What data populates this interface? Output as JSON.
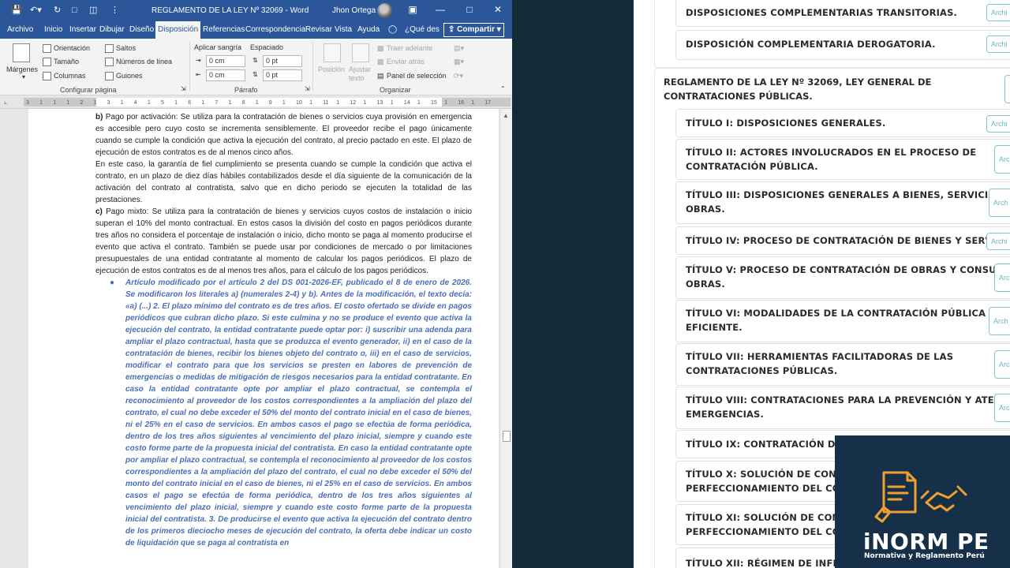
{
  "word": {
    "title": "REGLAMENTO DE LA LEY Nº 32069  -  Word",
    "user": "Jhon Ortega",
    "tabs": [
      "Archivo",
      "Inicio",
      "Insertar",
      "Dibujar",
      "Diseño",
      "Disposición",
      "Referencias",
      "Correspondencia",
      "Revisar",
      "Vista",
      "Ayuda"
    ],
    "active_tab": "Disposición",
    "tell_me": "¿Qué des",
    "share": "Compartir",
    "ribbon": {
      "margins": "Márgenes",
      "orientation": "Orientación",
      "size": "Tamaño",
      "columns": "Columnas",
      "breaks": "Saltos",
      "line_numbers": "Números de línea",
      "hyphenation": "Guiones",
      "group_page_setup": "Configurar página",
      "indent_label": "Aplicar sangría",
      "spacing_label": "Espaciado",
      "indent_left": "0 cm",
      "indent_right": "0 cm",
      "spacing_before": "0 pt",
      "spacing_after": "0 pt",
      "group_paragraph": "Párrafo",
      "position": "Posición",
      "wrap_line1": "Ajustar",
      "wrap_line2": "texto",
      "bring_forward": "Traer adelante",
      "send_backward": "Enviar atrás",
      "selection_pane": "Panel de selección",
      "group_arrange": "Organizar"
    },
    "ruler_ticks": [
      "3",
      "1",
      "1",
      "1",
      "2",
      "1",
      "3",
      "1",
      "4",
      "1",
      "5",
      "1",
      "6",
      "1",
      "7",
      "1",
      "8",
      "1",
      "9",
      "1",
      "10",
      "1",
      "11",
      "1",
      "12",
      "1",
      "13",
      "1",
      "14",
      "1",
      "15",
      "1",
      "16",
      "1",
      "17"
    ],
    "doc": {
      "para_b_label": "b)",
      "para_b": "Pago por activación: Se utiliza para la contratación de bienes o servicios cuya provisión en emergencia es accesible pero cuyo costo se incrementa sensiblemente. El proveedor recibe el pago únicamente cuando se cumple la condición que activa la ejecución del contrato, al precio pactado en este. El plazo de ejecución de estos contratos es de al menos cinco años.",
      "para_guarantee": "En este caso, la garantía de fiel cumplimiento se presenta cuando se cumple la condición que activa el contrato, en un plazo de diez días hábiles contabilizados desde el día siguiente de la comunicación de la activación del contrato al contratista, salvo que en dicho periodo se ejecuten la totalidad de las prestaciones.",
      "para_c_label": "c)",
      "para_c": "Pago mixto: Se utiliza para la contratación de bienes y servicios cuyos costos de instalación o inicio superan el 10% del monto contractual. En estos casos la división del costo en pagos periódicos durante tres años no considera el porcentaje de instalación o inicio, dicho monto se paga al momento producirse el evento que activa el contrato. También se puede usar por condiciones de mercado o por limitaciones presupuestales de una entidad contratante al momento de calcular los pagos periódicos. El plazo de ejecución de estos contratos es de al menos tres años, para el cálculo de los pagos periódicos.",
      "note": "Artículo modificado por el artículo 2 del DS 001-2026-EF, publicado el 8 de enero de 2026. Se modificaron los literales a) (numerales 2-4) y b). Antes de la modificación, el texto decía: «a) (...) 2. El plazo mínimo del contrato es de tres años. El costo ofertado se divide en pagos periódicos que cubran dicho plazo. Si este culmina y no se produce el evento que activa la ejecución del contrato, la entidad contratante puede optar por: i) suscribir una adenda para ampliar el plazo contractual, hasta que se produzca el evento generador, ii) en el caso de la contratación de bienes, recibir los bienes objeto del contrato o, iii) en el caso de servicios, modificar el contrato para que los servicios se presten en labores de prevención de emergencias o medidas de mitigación de riesgos necesarios para la entidad contratante. En caso la entidad contratante opte por ampliar el plazo contractual, se contempla el reconocimiento al proveedor de los costos correspondientes a la ampliación del plazo del contrato, el cual no debe exceder el 50% del monto del contrato inicial en el caso de bienes, ni el 25% en el caso de servicios. En ambos casos el pago se efectúa de forma periódica, dentro de los tres años siguientes al vencimiento del plazo inicial, siempre y cuando este costo forme parte de la propuesta inicial del contratista. En caso la entidad contratante opte por ampliar el plazo contractual, se contempla el reconocimiento al proveedor de los costos correspondientes a la ampliación del plazo del contrato, el cual no debe exceder el 50% del monto del contrato inicial en el caso de bienes, ni el 25% en el caso de servicios. En ambos casos el pago se efectúa de forma periódica, dentro de los tres años siguientes al vencimiento del plazo inicial, siempre y cuando este costo forme parte de la propuesta inicial del contratista. 3. De producirse el evento que activa la ejecución del contrato dentro de los primeros dieciocho meses de ejecución del contrato, la oferta debe indicar un costo de liquidación que se paga al contratista en"
    }
  },
  "web": {
    "top_items": [
      {
        "label": "DISPOSICIONES COMPLEMENTARIAS TRANSITORIAS.",
        "button": "Archi"
      },
      {
        "label": "DISPOSICIÓN COMPLEMENTARIA DEROGATORIA.",
        "button": "Archi"
      }
    ],
    "section_title": "REGLAMENTO DE LA LEY Nº 32069, LEY GENERAL DE CONTRATACIONES PÚBLICAS.",
    "titles": [
      {
        "line1": "TÍTULO I: DISPOSICIONES GENERALES.",
        "line2": "",
        "button": "Archi"
      },
      {
        "line1": "TÍTULO II: ACTORES INVOLUCRADOS EN EL PROCESO DE",
        "line2": "CONTRATACIÓN PÚBLICA.",
        "button": "Arc"
      },
      {
        "line1": "TÍTULO III: DISPOSICIONES GENERALES A BIENES, SERVICIOS Y",
        "line2": "OBRAS.",
        "button": "Arch"
      },
      {
        "line1": "TÍTULO IV: PROCESO DE CONTRATACIÓN DE BIENES Y SERVICIOS.",
        "line2": "",
        "button": "Archi"
      },
      {
        "line1": "TÍTULO V: PROCESO DE CONTRATACIÓN DE OBRAS Y CONSULTORÍA DE",
        "line2": "OBRAS.",
        "button": "Arc"
      },
      {
        "line1": "TÍTULO VI: MODALIDADES DE LA CONTRATACIÓN PÚBLICA",
        "line2": "EFICIENTE.",
        "button": "Arch"
      },
      {
        "line1": "TÍTULO VII: HERRAMIENTAS FACILITADORAS DE LAS",
        "line2": "CONTRATACIONES PÚBLICAS.",
        "button": "Arc"
      },
      {
        "line1": "TÍTULO VIII: CONTRATACIONES PARA LA PREVENCIÓN Y ATENCIÓN DE",
        "line2": "EMERGENCIAS.",
        "button": "Arc"
      },
      {
        "line1": "TÍTULO IX: CONTRATACIÓN DE BIE",
        "line2": "",
        "button": ""
      },
      {
        "line1": "TÍTULO X: SOLUCIÓN DE CONTROV",
        "line2": "PERFECCIONAMIENTO DEL CONTR",
        "button": ""
      },
      {
        "line1": "TÍTULO XI: SOLUCIÓN DE CONTRO",
        "line2": "PERFECCIONAMIENTO DEL CONTR",
        "button": ""
      },
      {
        "line1": "TÍTULO XII: RÉGIMEN DE INFRACCI",
        "line2": "",
        "button": ""
      }
    ]
  },
  "logo": {
    "brand": "iNORM PE",
    "tagline": "Normativa y Reglamento Perú",
    "accent": "#f0a030"
  }
}
